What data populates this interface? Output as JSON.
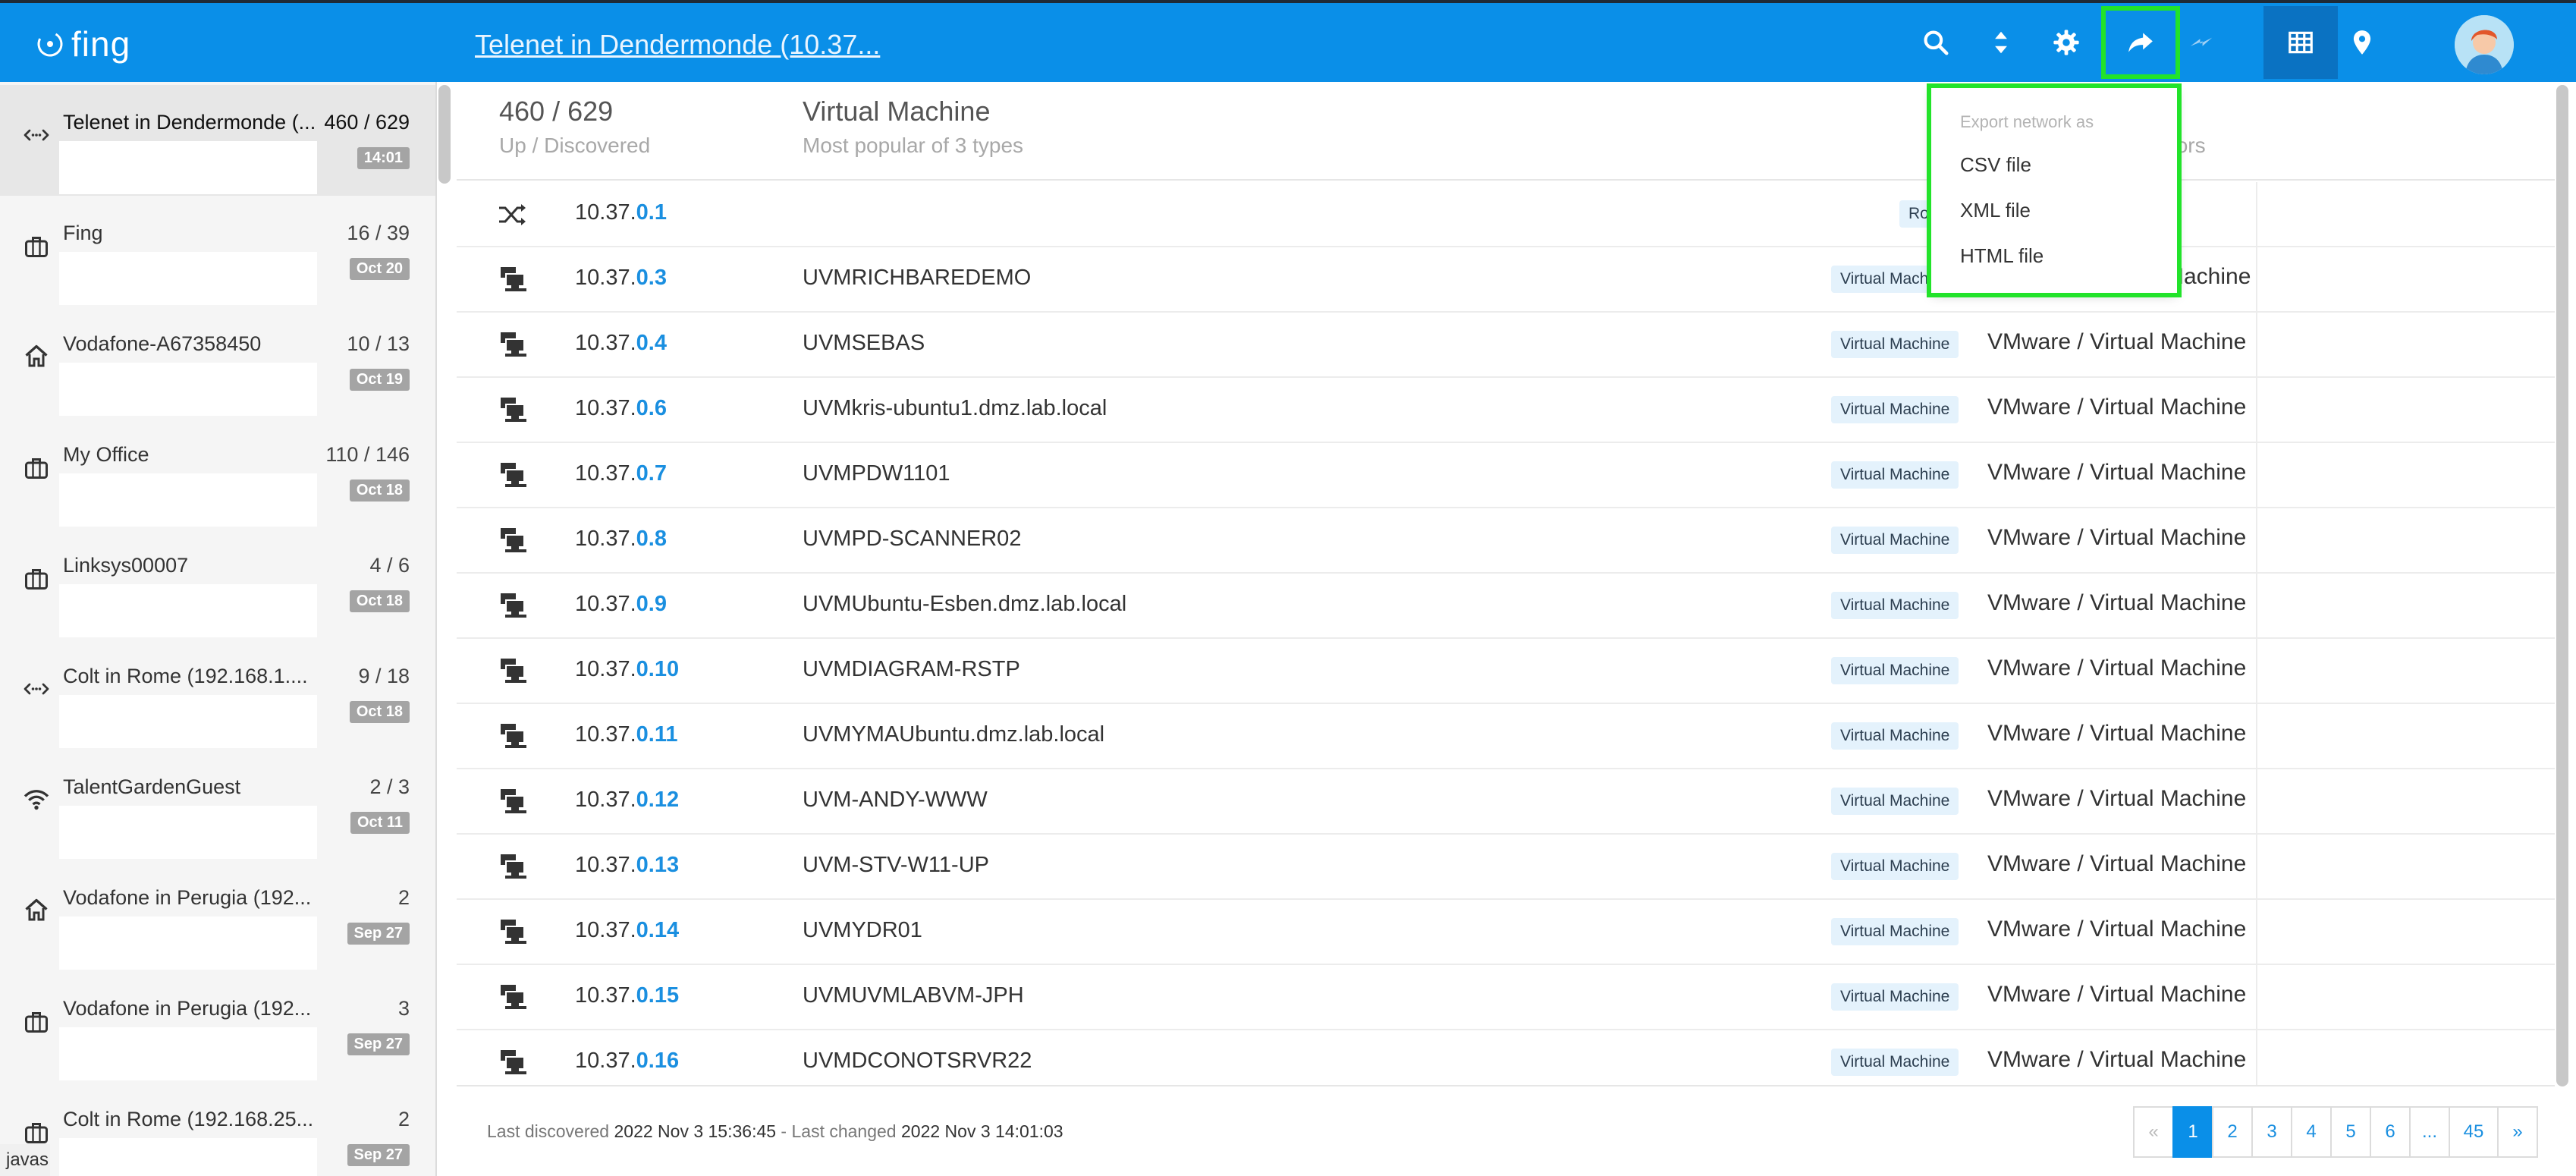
{
  "app": {
    "logo_text": "fing",
    "network_title": "Telenet in Dendermonde (10.37..."
  },
  "toolbar": {
    "icons": [
      "search-icon",
      "sort-icon",
      "gear-icon",
      "share-icon",
      "flash-icon",
      "table-icon",
      "location-pin-icon",
      "user-avatar"
    ]
  },
  "sidebar": {
    "items": [
      {
        "name": "Telenet in Dendermonde (...",
        "count": "460 / 629",
        "date": "14:01",
        "icon": "ethernet-icon",
        "active": true
      },
      {
        "name": "Fing",
        "count": "16 / 39",
        "date": "Oct 20",
        "icon": "briefcase-icon"
      },
      {
        "name": "Vodafone-A67358450",
        "count": "10 / 13",
        "date": "Oct 19",
        "icon": "home-icon"
      },
      {
        "name": "My Office",
        "count": "110 / 146",
        "date": "Oct 18",
        "icon": "briefcase-icon"
      },
      {
        "name": "Linksys00007",
        "count": "4 / 6",
        "date": "Oct 18",
        "icon": "briefcase-icon"
      },
      {
        "name": "Colt in Rome (192.168.1....",
        "count": "9 / 18",
        "date": "Oct 18",
        "icon": "ethernet-icon"
      },
      {
        "name": "TalentGardenGuest",
        "count": "2 / 3",
        "date": "Oct 11",
        "icon": "wifi-icon"
      },
      {
        "name": "Vodafone in Perugia (192...",
        "count": "2",
        "date": "Sep 27",
        "icon": "home-icon"
      },
      {
        "name": "Vodafone in Perugia (192...",
        "count": "3",
        "date": "Sep 27",
        "icon": "briefcase-icon"
      },
      {
        "name": "Colt in Rome (192.168.25...",
        "count": "2",
        "date": "Sep 27",
        "icon": "briefcase-icon"
      }
    ],
    "status_text": "javas"
  },
  "summary": {
    "count_value": "460 / 629",
    "count_caption": "Up / Discovered",
    "type_value": "Virtual Machine",
    "type_caption": "Most popular of 3 types",
    "vendor_caption_partial": "endors"
  },
  "export_menu": {
    "header": "Export network as",
    "items": [
      "CSV file",
      "XML file",
      "HTML file"
    ]
  },
  "devices": [
    {
      "ip_prefix": "10.37.",
      "ip_suffix": "0.1",
      "name": "",
      "type": "Rou",
      "vendor": "",
      "icon": "router-icon"
    },
    {
      "ip_prefix": "10.37.",
      "ip_suffix": "0.3",
      "name": "UVMRICHBAREDEMO",
      "type": "Virtual Mach",
      "vendor": "Machine",
      "icon": "computer-icon"
    },
    {
      "ip_prefix": "10.37.",
      "ip_suffix": "0.4",
      "name": "UVMSEBAS",
      "type": "Virtual Machine",
      "vendor": "VMware / Virtual Machine",
      "icon": "computer-icon"
    },
    {
      "ip_prefix": "10.37.",
      "ip_suffix": "0.6",
      "name": "UVMkris-ubuntu1.dmz.lab.local",
      "type": "Virtual Machine",
      "vendor": "VMware / Virtual Machine",
      "icon": "computer-icon"
    },
    {
      "ip_prefix": "10.37.",
      "ip_suffix": "0.7",
      "name": "UVMPDW1101",
      "type": "Virtual Machine",
      "vendor": "VMware / Virtual Machine",
      "icon": "computer-icon"
    },
    {
      "ip_prefix": "10.37.",
      "ip_suffix": "0.8",
      "name": "UVMPD-SCANNER02",
      "type": "Virtual Machine",
      "vendor": "VMware / Virtual Machine",
      "icon": "computer-icon"
    },
    {
      "ip_prefix": "10.37.",
      "ip_suffix": "0.9",
      "name": "UVMUbuntu-Esben.dmz.lab.local",
      "type": "Virtual Machine",
      "vendor": "VMware / Virtual Machine",
      "icon": "computer-icon"
    },
    {
      "ip_prefix": "10.37.",
      "ip_suffix": "0.10",
      "name": "UVMDIAGRAM-RSTP",
      "type": "Virtual Machine",
      "vendor": "VMware / Virtual Machine",
      "icon": "computer-icon"
    },
    {
      "ip_prefix": "10.37.",
      "ip_suffix": "0.11",
      "name": "UVMYMAUbuntu.dmz.lab.local",
      "type": "Virtual Machine",
      "vendor": "VMware / Virtual Machine",
      "icon": "computer-icon"
    },
    {
      "ip_prefix": "10.37.",
      "ip_suffix": "0.12",
      "name": "UVM-ANDY-WWW",
      "type": "Virtual Machine",
      "vendor": "VMware / Virtual Machine",
      "icon": "computer-icon"
    },
    {
      "ip_prefix": "10.37.",
      "ip_suffix": "0.13",
      "name": "UVM-STV-W11-UP",
      "type": "Virtual Machine",
      "vendor": "VMware / Virtual Machine",
      "icon": "computer-icon"
    },
    {
      "ip_prefix": "10.37.",
      "ip_suffix": "0.14",
      "name": "UVMYDR01",
      "type": "Virtual Machine",
      "vendor": "VMware / Virtual Machine",
      "icon": "computer-icon"
    },
    {
      "ip_prefix": "10.37.",
      "ip_suffix": "0.15",
      "name": "UVMUVMLABVM-JPH",
      "type": "Virtual Machine",
      "vendor": "VMware / Virtual Machine",
      "icon": "computer-icon"
    },
    {
      "ip_prefix": "10.37.",
      "ip_suffix": "0.16",
      "name": "UVMDCONOTSRVR22",
      "type": "Virtual Machine",
      "vendor": "VMware / Virtual Machine",
      "icon": "computer-icon"
    }
  ],
  "footer": {
    "discovered_label": "Last discovered ",
    "discovered_value": "2022 Nov 3 15:36:45",
    "changed_label": " - Last changed ",
    "changed_value": "2022 Nov 3 14:01:03"
  },
  "pagination": {
    "prev": "«",
    "pages": [
      "1",
      "2",
      "3",
      "4",
      "5",
      "6",
      "...",
      "45"
    ],
    "next": "»",
    "current": "1"
  },
  "colors": {
    "accent": "#0a8fe8",
    "highlight": "#22e32a",
    "link": "#1a8fe0",
    "badge": "#e4f2fc",
    "date_badge": "#a4a4a4"
  }
}
